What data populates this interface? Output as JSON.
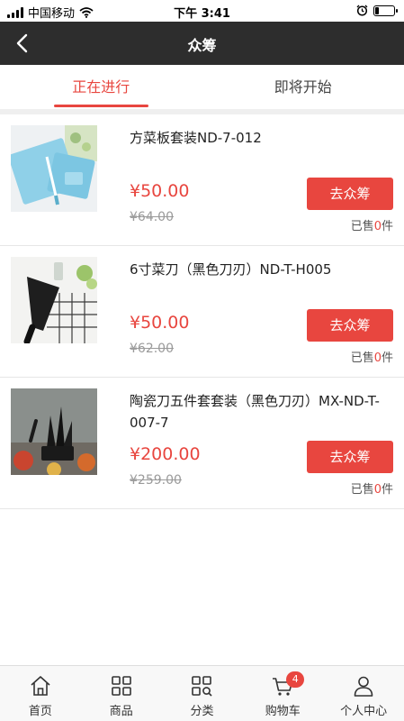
{
  "status_bar": {
    "carrier": "中国移动",
    "time": "下午 3:41",
    "battery_level": 0.2
  },
  "nav": {
    "title": "众筹",
    "back_icon": "chevron-left-icon"
  },
  "tabs": [
    {
      "label": "正在进行",
      "active": true
    },
    {
      "label": "即将开始",
      "active": false
    }
  ],
  "items": [
    {
      "title": "方菜板套装ND-7-012",
      "price": "¥50.00",
      "old_price": "¥64.00",
      "button": "去众筹",
      "sold_prefix": "已售",
      "sold_count": "0",
      "sold_suffix": "件"
    },
    {
      "title": "6寸菜刀（黑色刀刃）ND-T-H005",
      "price": "¥50.00",
      "old_price": "¥62.00",
      "button": "去众筹",
      "sold_prefix": "已售",
      "sold_count": "0",
      "sold_suffix": "件"
    },
    {
      "title": "陶瓷刀五件套套装（黑色刀刃）MX-ND-T-007-7",
      "price": "¥200.00",
      "old_price": "¥259.00",
      "button": "去众筹",
      "sold_prefix": "已售",
      "sold_count": "0",
      "sold_suffix": "件"
    }
  ],
  "bottom_nav": [
    {
      "label": "首页",
      "icon": "home-icon"
    },
    {
      "label": "商品",
      "icon": "grid-icon"
    },
    {
      "label": "分类",
      "icon": "category-search-icon"
    },
    {
      "label": "购物车",
      "icon": "cart-icon",
      "badge": "4"
    },
    {
      "label": "个人中心",
      "icon": "user-icon"
    }
  ],
  "colors": {
    "accent": "#e8463f",
    "nav_bg": "#2d2d2d"
  }
}
